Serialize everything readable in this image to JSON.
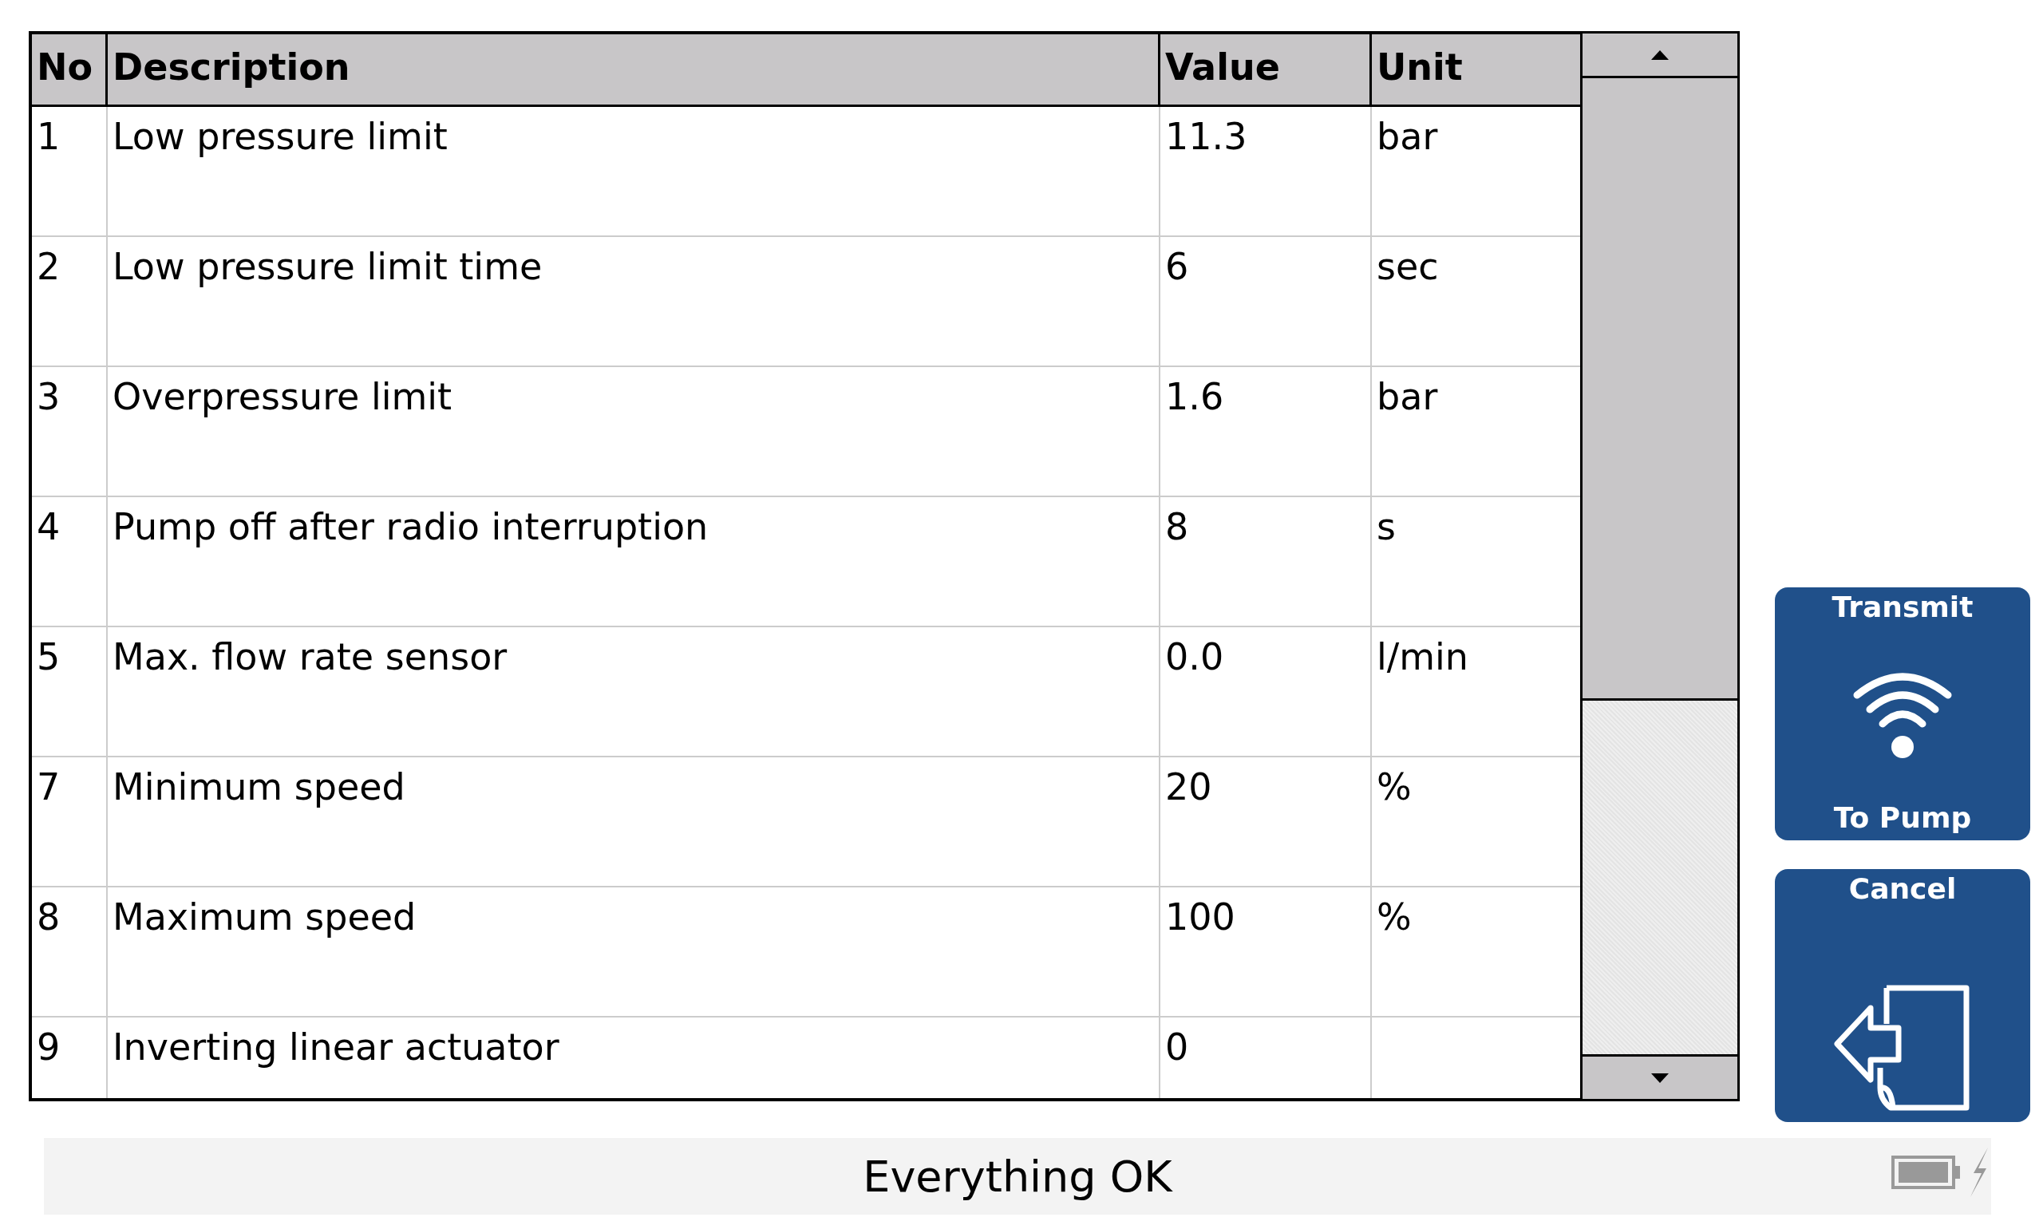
{
  "table": {
    "columns": [
      "No",
      "Description",
      "Value",
      "Unit"
    ],
    "rows": [
      {
        "no": "1",
        "description": "Low pressure limit",
        "value": "11.3",
        "unit": "bar"
      },
      {
        "no": "2",
        "description": "Low pressure limit time",
        "value": "6",
        "unit": "sec"
      },
      {
        "no": "3",
        "description": "Overpressure limit",
        "value": "1.6",
        "unit": "bar"
      },
      {
        "no": "4",
        "description": "Pump off after radio interruption",
        "value": "8",
        "unit": "s"
      },
      {
        "no": "5",
        "description": "Max. flow rate sensor",
        "value": "0.0",
        "unit": "l/min"
      },
      {
        "no": "7",
        "description": "Minimum speed",
        "value": "20",
        "unit": "%"
      },
      {
        "no": "8",
        "description": "Maximum speed",
        "value": "100",
        "unit": "%"
      },
      {
        "no": "9",
        "description": "Inverting linear actuator",
        "value": "0"
      }
    ]
  },
  "buttons": [
    {
      "kind": "transmit",
      "label": "Transmit",
      "sublabel": "To Pump"
    },
    {
      "kind": "cancel",
      "label": "Cancel"
    }
  ],
  "status_bar": {
    "message": "Everything OK",
    "charging": true
  }
}
